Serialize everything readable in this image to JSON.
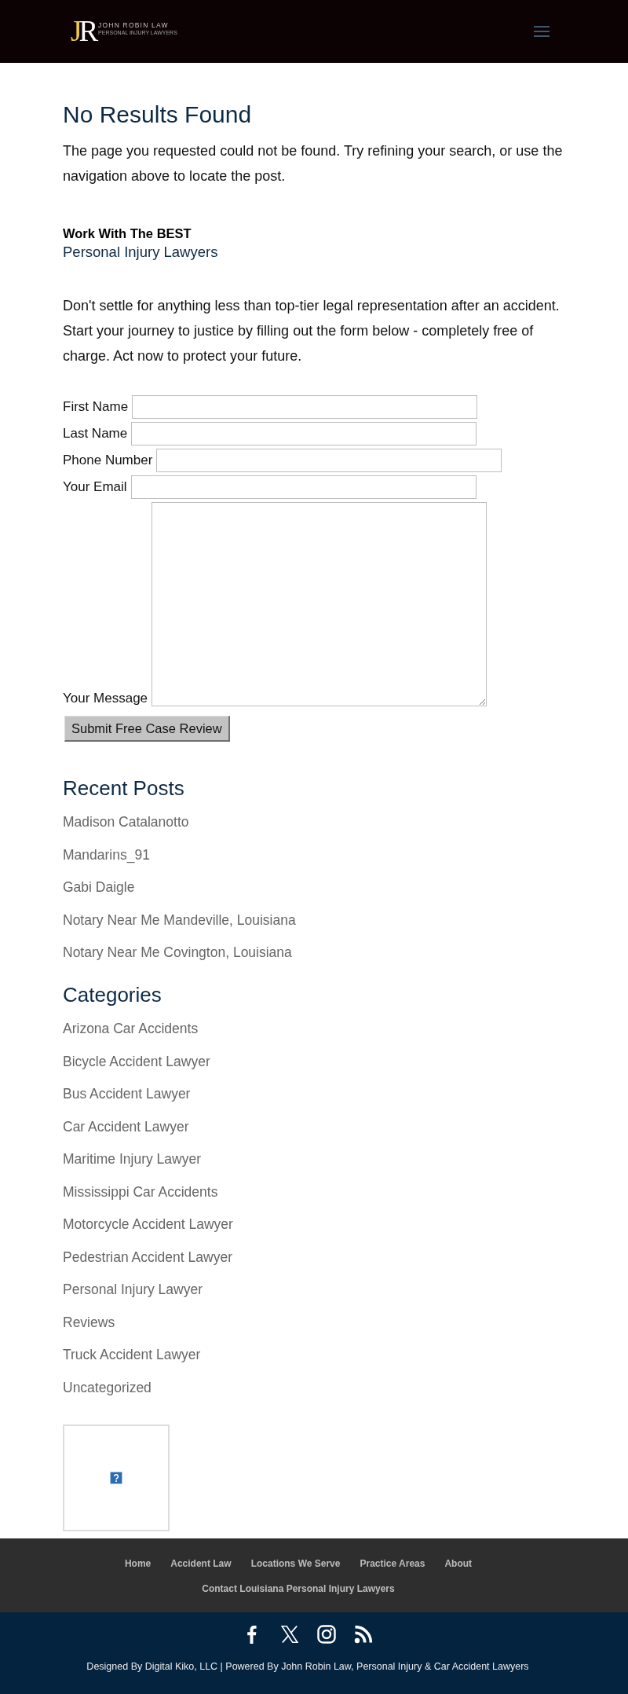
{
  "header": {
    "logo": {
      "monogram": "JR",
      "name": "JOHN ROBIN LAW",
      "tagline": "PERSONAL INJURY LAWYERS"
    }
  },
  "content": {
    "title": "No Results Found",
    "message": "The page you requested could not be found. Try refining your search, or use the navigation above to locate the post.",
    "promo": {
      "heading": "Work With The BEST",
      "subheading": "Personal Injury Lawyers",
      "text": "Don't settle for anything less than top-tier legal representation after an accident. Start your journey to justice by filling out the form below - completely free of charge. Act now to protect your future."
    },
    "form": {
      "fields": [
        {
          "kind": "text",
          "label": "First Name"
        },
        {
          "kind": "text",
          "label": "Last Name"
        },
        {
          "kind": "text",
          "label": "Phone Number"
        },
        {
          "kind": "text",
          "label": "Your Email"
        },
        {
          "kind": "textarea",
          "label": "Your Message"
        }
      ],
      "submit": "Submit Free Case Review"
    }
  },
  "recent_posts": {
    "title": "Recent Posts",
    "items": [
      "Madison Catalanotto",
      "Mandarins_91",
      "Gabi Daigle",
      "Notary Near Me Mandeville, Louisiana",
      "Notary Near Me Covington, Louisiana"
    ]
  },
  "categories": {
    "title": "Categories",
    "items": [
      "Arizona Car Accidents",
      "Bicycle Accident Lawyer",
      "Bus Accident Lawyer",
      "Car Accident Lawyer",
      "Maritime Injury Lawyer",
      "Mississippi Car Accidents",
      "Motorcycle Accident Lawyer",
      "Pedestrian Accident Lawyer",
      "Personal Injury Lawyer",
      "Reviews",
      "Truck Accident Lawyer",
      "Uncategorized"
    ]
  },
  "footer": {
    "menu": [
      "Home",
      "Accident Law",
      "Locations We Serve",
      "Practice Areas",
      "About",
      "Contact Louisiana Personal Injury Lawyers"
    ],
    "social": [
      {
        "kind": "facebook"
      },
      {
        "kind": "x"
      },
      {
        "kind": "instagram"
      },
      {
        "kind": "rss"
      }
    ],
    "credit": "Designed By Digital Kiko, LLC | Powered By John Robin Law, Personal Injury & Car Accident Lawyers"
  }
}
